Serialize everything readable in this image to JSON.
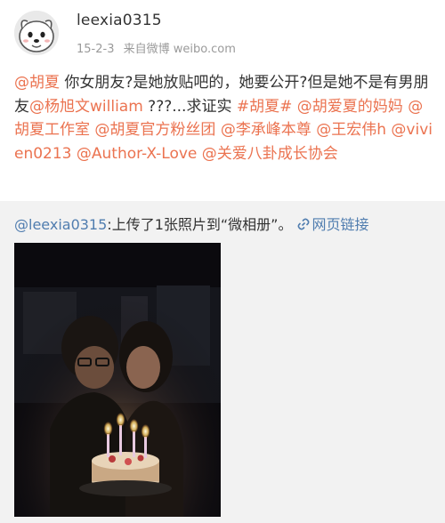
{
  "header": {
    "username": "leexia0315",
    "date": "15-2-3",
    "source": "来自微博 weibo.com",
    "avatar_icon": "white-dog-face-avatar"
  },
  "post": {
    "line1_mention": "@胡夏",
    "line1_text": " 你女朋友?是她放贴吧的，她要公开?但是她不是有男朋友",
    "mention_yang": "@杨旭文william",
    "text_ask": " ???...求证实 ",
    "topic": "#胡夏#",
    "sp1": " ",
    "mention_mom": "@胡爱夏的妈妈",
    "sp2": " ",
    "mention_studio": "@胡夏工作室",
    "sp3": " ",
    "mention_fans": "@胡夏官方粉丝团",
    "sp4": " ",
    "mention_li": "@李承峰本尊",
    "sp5": " ",
    "mention_wang": "@王宏伟h",
    "sp6": " ",
    "mention_vivien": "@vivien0213",
    "sp7": " ",
    "mention_author": "@Author-X-Love",
    "sp8": " ",
    "mention_gossip": "@关爱八卦成长协会"
  },
  "repost": {
    "user": "@leexia0315",
    "text": ":上传了1张照片到“微相册”。",
    "weblink_label": "网页链接",
    "weblink_icon": "link-icon"
  },
  "photo": {
    "subject": "couple-with-birthday-cake-photo"
  },
  "colors": {
    "mention": "#eb7350",
    "repost_link": "#507daf",
    "meta": "#9a9a9a",
    "repost_bg": "#f2f2f2"
  }
}
